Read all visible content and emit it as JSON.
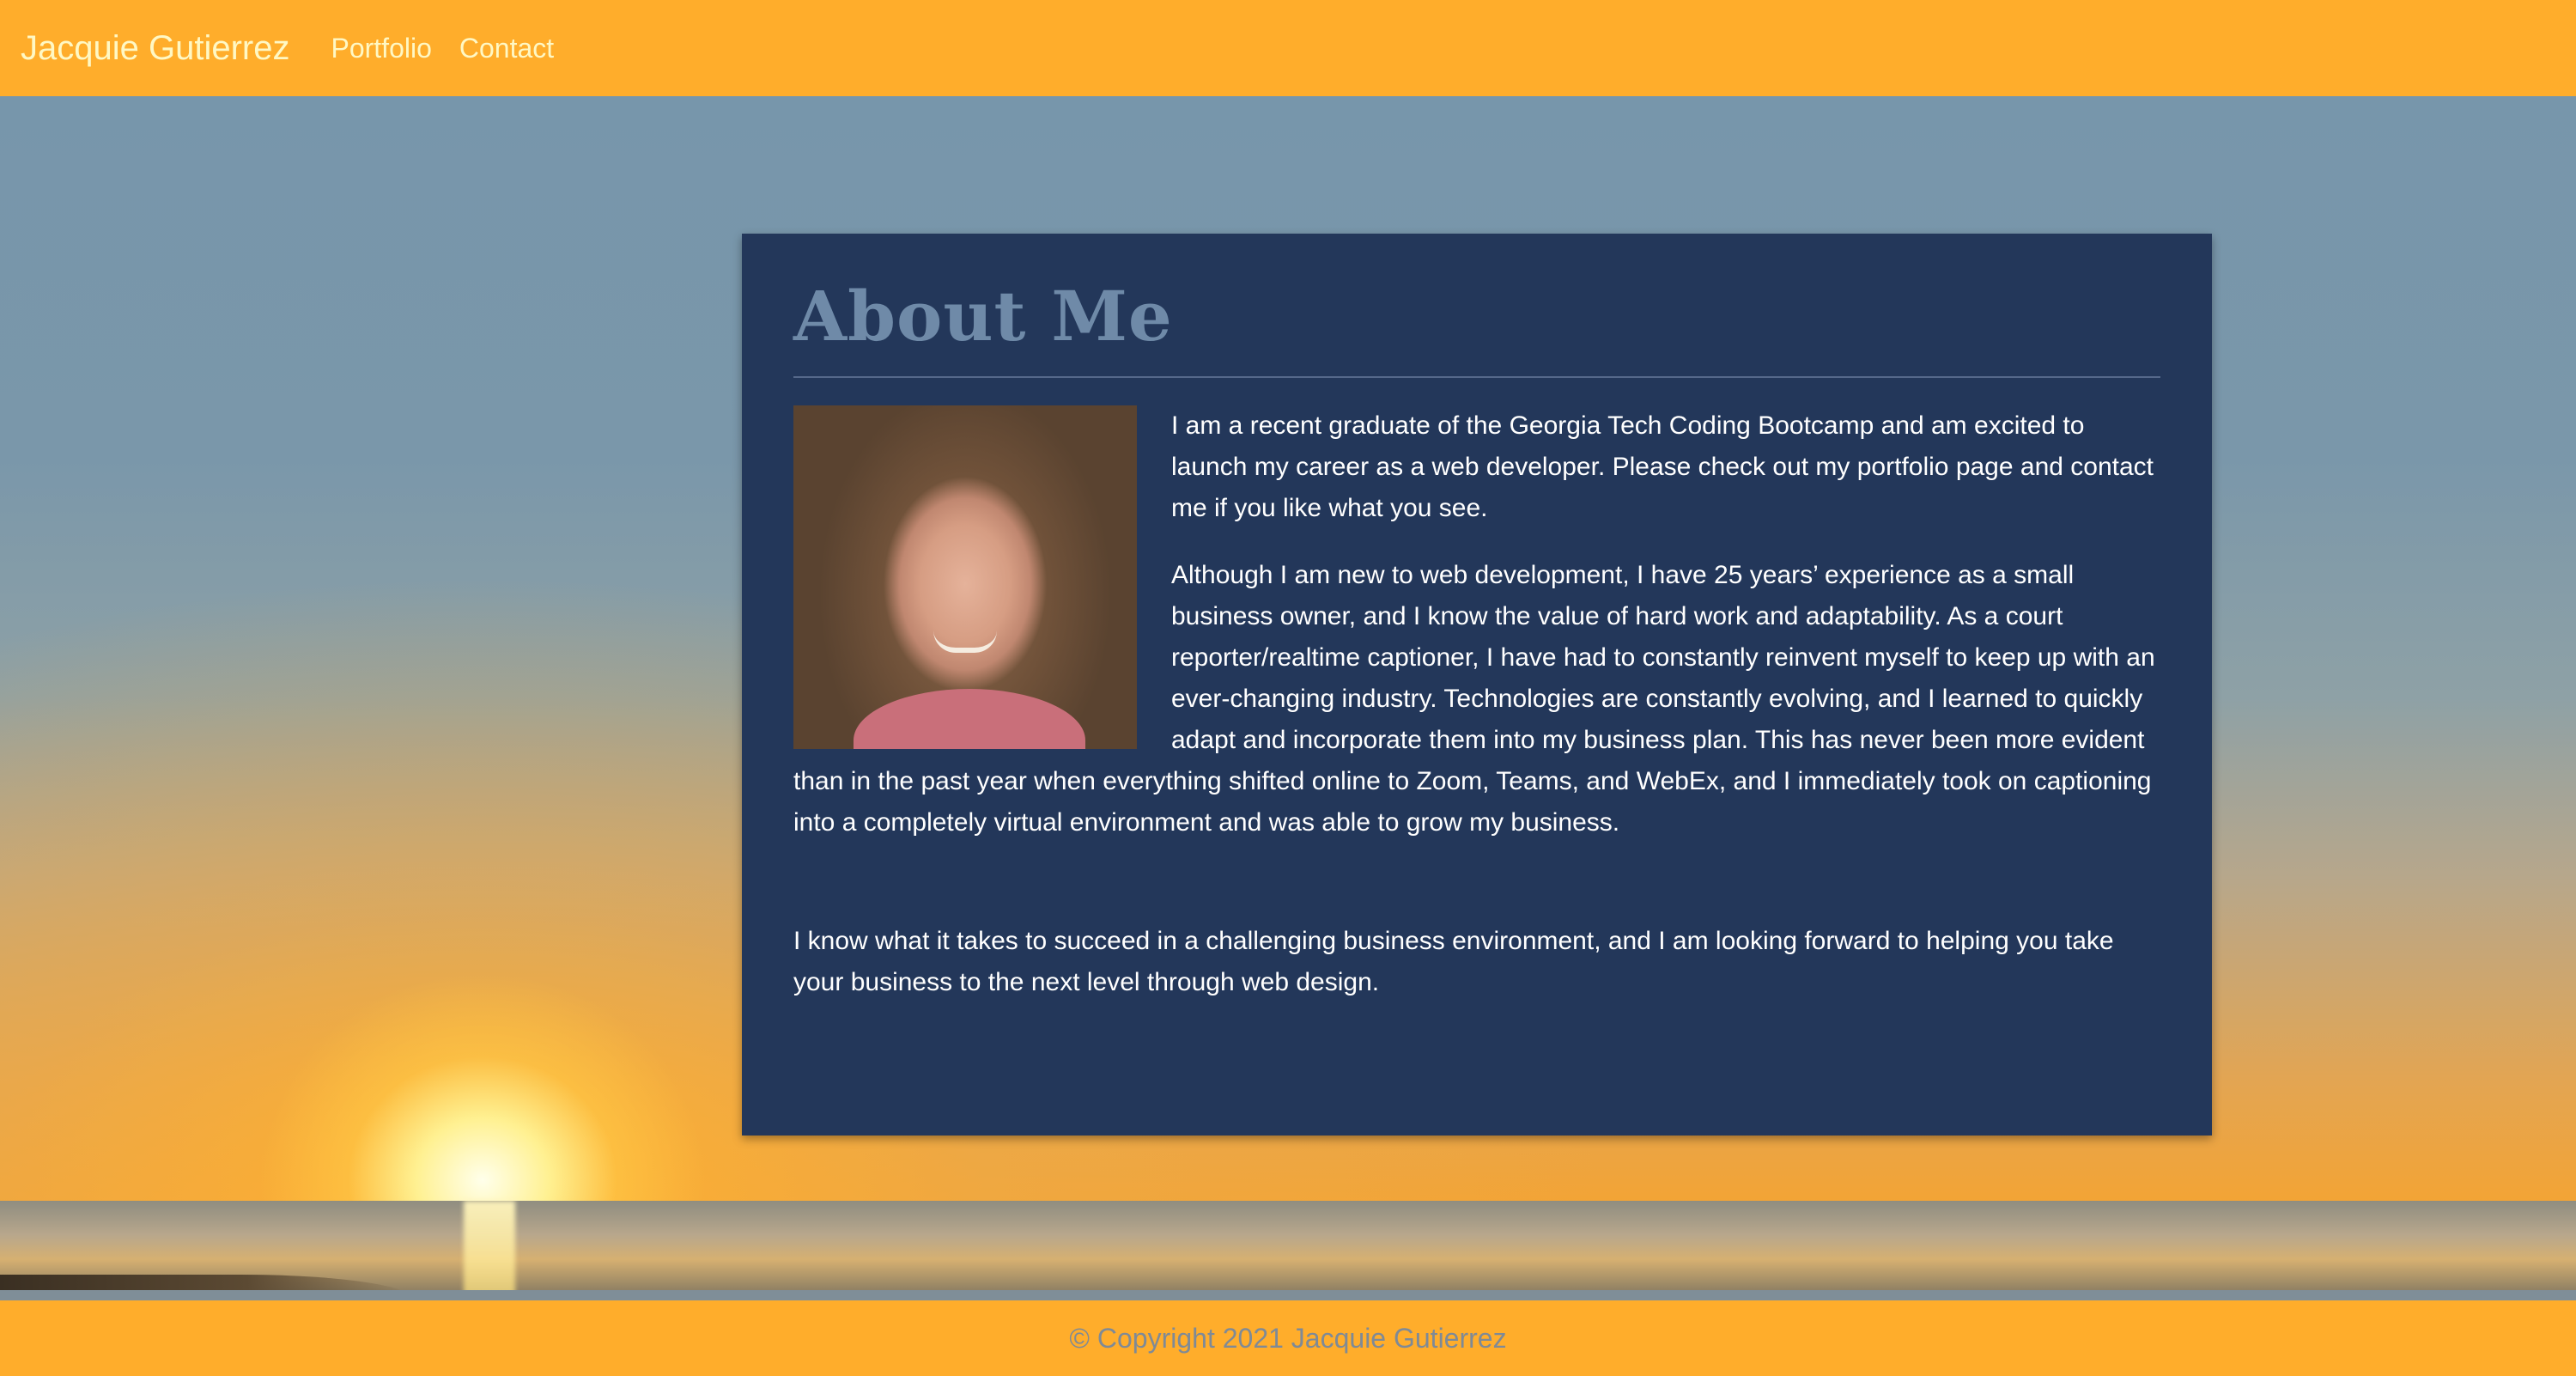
{
  "navbar": {
    "brand": "Jacquie Gutierrez",
    "links": [
      {
        "label": "Portfolio"
      },
      {
        "label": "Contact"
      }
    ]
  },
  "about": {
    "title": "About Me",
    "paragraphs": [
      "I am a recent graduate of the Georgia Tech Coding Bootcamp and am excited to launch my career as a web developer. Please check out my portfolio page and contact me if you like what you see.",
      "Although I am new to web development, I have 25 years’ experience as a small business owner, and I know the value of hard work and adaptability. As a court reporter/realtime captioner, I have had to constantly reinvent myself to keep up with an ever-changing industry. Technologies are constantly evolving, and I learned to quickly adapt and incorporate them into my business plan. This has never been more evident than in the past year when everything shifted online to Zoom, Teams, and WebEx, and I immediately took on captioning into a completely virtual environment and was able to grow my business.",
      "I know what it takes to succeed in a challenging business environment, and I am looking forward to helping you take your business to the next level through web design."
    ]
  },
  "footer": {
    "copyright": "© Copyright 2021 Jacquie Gutierrez"
  },
  "colors": {
    "header_bg": "#ffad2b",
    "header_text": "#fff8c4",
    "card_bg": "#23375a",
    "card_title": "#6f8aa8",
    "footer_text": "#7f8a96"
  }
}
